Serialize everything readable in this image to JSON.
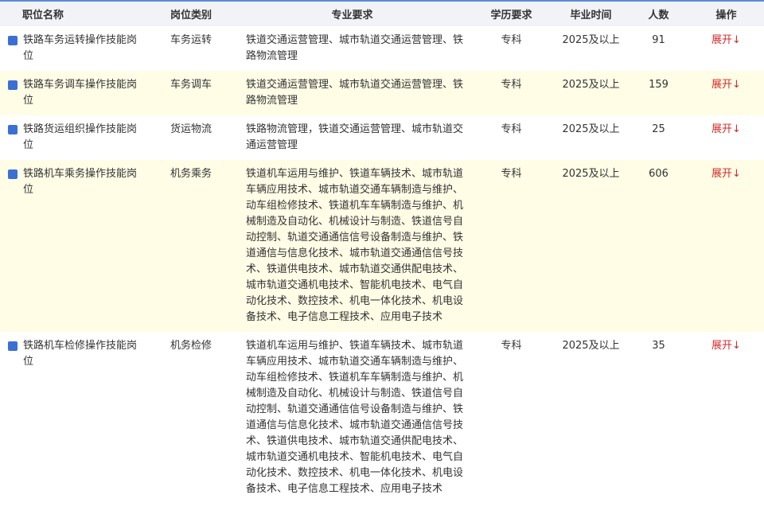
{
  "table": {
    "headers": {
      "name": "职位名称",
      "category": "岗位类别",
      "major": "专业要求",
      "education": "学历要求",
      "grad_year": "毕业时间",
      "count": "人数",
      "action": "操作"
    },
    "rows": [
      {
        "name": "铁路车务运转操作技能岗位",
        "category": "车务运转",
        "major": "铁道交通运营管理、城市轨道交通运营管理、铁路物流管理",
        "education": "专科",
        "grad_year": "2025及以上",
        "count": "91",
        "action": "展开↓"
      },
      {
        "name": "铁路车务调车操作技能岗位",
        "category": "车务调车",
        "major": "铁道交通运营管理、城市轨道交通运营管理、铁路物流管理",
        "education": "专科",
        "grad_year": "2025及以上",
        "count": "159",
        "action": "展开↓"
      },
      {
        "name": "铁路货运组织操作技能岗位",
        "category": "货运物流",
        "major": "铁路物流管理，铁道交通运营管理、城市轨道交通运营管理",
        "education": "专科",
        "grad_year": "2025及以上",
        "count": "25",
        "action": "展开↓"
      },
      {
        "name": "铁路机车乘务操作技能岗位",
        "category": "机务乘务",
        "major": "铁道机车运用与维护、铁道车辆技术、城市轨道车辆应用技术、城市轨道交通车辆制造与维护、动车组检修技术、铁道机车车辆制造与维护、机械制造及自动化、机械设计与制造、铁道信号自动控制、轨道交通通信信号设备制造与维护、铁道通信与信息化技术、城市轨道交通通信信号技术、铁道供电技术、城市轨道交通供配电技术、城市轨道交通机电技术、智能机电技术、电气自动化技术、数控技术、机电一体化技术、机电设备技术、电子信息工程技术、应用电子技术",
        "education": "专科",
        "grad_year": "2025及以上",
        "count": "606",
        "action": "展开↓"
      },
      {
        "name": "铁路机车检修操作技能岗位",
        "category": "机务检修",
        "major": "铁道机车运用与维护、铁道车辆技术、城市轨道车辆应用技术、城市轨道交通车辆制造与维护、动车组检修技术、铁道机车车辆制造与维护、机械制造及自动化、机械设计与制造、铁道信号自动控制、轨道交通通信信号设备制造与维护、铁道通信与信息化技术、城市轨道交通通信信号技术、铁道供电技术、城市轨道交通供配电技术、城市轨道交通机电技术、智能机电技术、电气自动化技术、数控技术、机电一体化技术、机电设备技术、电子信息工程技术、应用电子技术",
        "education": "专科",
        "grad_year": "2025及以上",
        "count": "35",
        "action": "展开↓"
      }
    ]
  }
}
